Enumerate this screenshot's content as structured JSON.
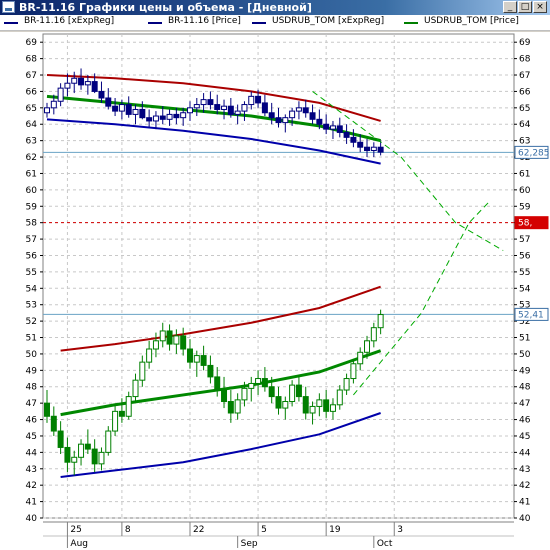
{
  "window": {
    "title": "BR-11.16 Графики цены и объема - [Дневной]",
    "buttons": [
      "_",
      "□",
      "×"
    ]
  },
  "legend": [
    {
      "label": "BR-11.16 [xExpReg]",
      "color": "#00007f"
    },
    {
      "label": "BR-11.16 [Price]",
      "color": "#00007f"
    },
    {
      "label": "USDRUB_TOM [xExpReg]",
      "color": "#00007f"
    },
    {
      "label": "USDRUB_TOM [Price]",
      "color": "#007f00"
    }
  ],
  "chart_data": {
    "type": "line",
    "ylim": [
      40,
      69.5
    ],
    "yticks": [
      40,
      41,
      42,
      43,
      44,
      45,
      46,
      47,
      48,
      49,
      50,
      51,
      52,
      53,
      54,
      55,
      56,
      57,
      58,
      59,
      60,
      61,
      62,
      63,
      64,
      65,
      66,
      67,
      68,
      69
    ],
    "xlim": [
      0,
      68
    ],
    "xticks": [
      {
        "x": 3,
        "label": "25"
      },
      {
        "x": 11,
        "label": "8"
      },
      {
        "x": 21,
        "label": "22"
      },
      {
        "x": 31,
        "label": "5"
      },
      {
        "x": 41,
        "label": "19"
      },
      {
        "x": 51,
        "label": "3"
      }
    ],
    "months": [
      {
        "x": 3,
        "label": "Aug"
      },
      {
        "x": 28,
        "label": "Sep"
      },
      {
        "x": 48,
        "label": "Oct"
      }
    ],
    "price_tags": [
      {
        "value": 62.285,
        "label": "62,285",
        "color": "#3a6ea5",
        "bg": "#ffffff",
        "line": "#6aa2c4",
        "dash": false
      },
      {
        "value": 58.0,
        "label": "58,",
        "color": "#ffffff",
        "bg": "#d40000",
        "line": "#d40000",
        "dash": true
      },
      {
        "value": 52.41,
        "label": "52,41",
        "color": "#3a6ea5",
        "bg": "#ffffff",
        "line": "#6aa2c4",
        "dash": false
      }
    ],
    "series": [
      {
        "name": "BR-11.16 [Price]",
        "kind": "candle",
        "color": "#00007f",
        "fill": "#ffffff",
        "values": [
          [
            0,
            64.7,
            65.3,
            64.4,
            65.0
          ],
          [
            1,
            65.0,
            65.8,
            64.6,
            65.4
          ],
          [
            2,
            65.4,
            66.5,
            65.1,
            66.2
          ],
          [
            3,
            66.2,
            67.1,
            65.7,
            66.5
          ],
          [
            4,
            66.5,
            67.2,
            65.9,
            66.8
          ],
          [
            5,
            66.8,
            67.4,
            66.1,
            66.4
          ],
          [
            6,
            66.4,
            67.0,
            65.8,
            66.6
          ],
          [
            7,
            66.6,
            67.1,
            65.9,
            66.0
          ],
          [
            8,
            66.0,
            66.6,
            65.3,
            65.6
          ],
          [
            9,
            65.6,
            66.2,
            64.9,
            65.1
          ],
          [
            10,
            65.1,
            65.6,
            64.5,
            64.8
          ],
          [
            11,
            64.8,
            65.5,
            64.3,
            65.2
          ],
          [
            12,
            65.2,
            65.7,
            64.4,
            64.6
          ],
          [
            13,
            64.6,
            65.2,
            64.0,
            64.9
          ],
          [
            14,
            64.9,
            65.4,
            64.3,
            64.4
          ],
          [
            15,
            64.4,
            64.9,
            63.8,
            64.2
          ],
          [
            16,
            64.2,
            64.8,
            63.7,
            64.5
          ],
          [
            17,
            64.5,
            65.1,
            64.0,
            64.3
          ],
          [
            18,
            64.3,
            64.9,
            63.9,
            64.6
          ],
          [
            19,
            64.6,
            65.0,
            64.0,
            64.4
          ],
          [
            20,
            64.4,
            65.0,
            63.9,
            64.7
          ],
          [
            21,
            64.7,
            65.4,
            64.2,
            65.0
          ],
          [
            22,
            65.0,
            65.6,
            64.5,
            65.2
          ],
          [
            23,
            65.2,
            65.9,
            64.7,
            65.5
          ],
          [
            24,
            65.5,
            66.0,
            64.9,
            65.2
          ],
          [
            25,
            65.2,
            65.8,
            64.6,
            64.9
          ],
          [
            26,
            64.9,
            65.5,
            64.3,
            65.1
          ],
          [
            27,
            65.1,
            65.6,
            64.4,
            64.6
          ],
          [
            28,
            64.6,
            65.2,
            64.0,
            64.8
          ],
          [
            29,
            64.8,
            65.4,
            64.2,
            65.2
          ],
          [
            30,
            65.2,
            66.0,
            64.9,
            65.7
          ],
          [
            31,
            65.7,
            66.1,
            65.0,
            65.3
          ],
          [
            32,
            65.3,
            65.8,
            64.5,
            64.7
          ],
          [
            33,
            64.7,
            65.3,
            64.0,
            64.4
          ],
          [
            34,
            64.4,
            65.0,
            63.8,
            64.1
          ],
          [
            35,
            64.1,
            64.6,
            63.5,
            64.4
          ],
          [
            36,
            64.4,
            65.0,
            63.9,
            64.8
          ],
          [
            37,
            64.8,
            65.4,
            64.3,
            65.0
          ],
          [
            38,
            65.0,
            65.5,
            64.4,
            64.7
          ],
          [
            39,
            64.7,
            65.2,
            64.0,
            64.3
          ],
          [
            40,
            64.3,
            64.9,
            63.7,
            64.0
          ],
          [
            41,
            64.0,
            64.6,
            63.4,
            63.7
          ],
          [
            42,
            63.7,
            64.2,
            63.1,
            63.9
          ],
          [
            43,
            63.9,
            64.4,
            63.2,
            63.5
          ],
          [
            44,
            63.5,
            64.0,
            62.8,
            63.2
          ],
          [
            45,
            63.2,
            63.7,
            62.6,
            62.9
          ],
          [
            46,
            62.9,
            63.4,
            62.3,
            62.6
          ],
          [
            47,
            62.6,
            63.1,
            62.0,
            62.4
          ],
          [
            48,
            62.4,
            62.9,
            62.0,
            62.6
          ],
          [
            49,
            62.6,
            63.0,
            62.1,
            62.3
          ]
        ]
      },
      {
        "name": "USDRUB_TOM [Price]",
        "kind": "candle",
        "color": "#007f00",
        "fill": "#ffffff",
        "values": [
          [
            0,
            47.0,
            47.8,
            45.8,
            46.2
          ],
          [
            1,
            46.2,
            46.8,
            45.0,
            45.3
          ],
          [
            2,
            45.3,
            45.9,
            43.9,
            44.3
          ],
          [
            3,
            44.3,
            44.9,
            42.8,
            43.4
          ],
          [
            4,
            43.4,
            44.1,
            42.6,
            43.7
          ],
          [
            5,
            43.7,
            44.8,
            43.2,
            44.5
          ],
          [
            6,
            44.5,
            45.4,
            43.9,
            44.2
          ],
          [
            7,
            44.2,
            44.8,
            42.8,
            43.3
          ],
          [
            8,
            43.3,
            44.3,
            42.9,
            44.0
          ],
          [
            9,
            44.0,
            45.6,
            43.8,
            45.3
          ],
          [
            10,
            45.3,
            46.9,
            45.0,
            46.5
          ],
          [
            11,
            46.5,
            47.3,
            45.8,
            46.2
          ],
          [
            12,
            46.2,
            47.7,
            46.0,
            47.4
          ],
          [
            13,
            47.4,
            48.8,
            47.1,
            48.4
          ],
          [
            14,
            48.4,
            49.9,
            48.0,
            49.5
          ],
          [
            15,
            49.5,
            50.8,
            49.1,
            50.3
          ],
          [
            16,
            50.3,
            51.3,
            49.8,
            50.8
          ],
          [
            17,
            50.8,
            51.9,
            50.4,
            51.4
          ],
          [
            18,
            51.4,
            51.8,
            50.2,
            50.6
          ],
          [
            19,
            50.6,
            51.5,
            50.0,
            51.1
          ],
          [
            20,
            51.1,
            51.6,
            49.9,
            50.3
          ],
          [
            21,
            50.3,
            50.9,
            49.1,
            49.5
          ],
          [
            22,
            49.5,
            50.2,
            48.6,
            49.9
          ],
          [
            23,
            49.9,
            50.5,
            49.0,
            49.3
          ],
          [
            24,
            49.3,
            49.9,
            48.2,
            48.6
          ],
          [
            25,
            48.6,
            49.2,
            47.4,
            47.8
          ],
          [
            26,
            47.8,
            48.6,
            46.7,
            47.1
          ],
          [
            27,
            47.1,
            47.8,
            45.8,
            46.4
          ],
          [
            28,
            46.4,
            47.6,
            46.0,
            47.2
          ],
          [
            29,
            47.2,
            48.3,
            46.8,
            47.9
          ],
          [
            30,
            47.9,
            48.6,
            47.1,
            48.2
          ],
          [
            31,
            48.2,
            49.0,
            47.5,
            48.5
          ],
          [
            32,
            48.5,
            49.2,
            47.7,
            48.0
          ],
          [
            33,
            48.0,
            48.6,
            47.0,
            47.4
          ],
          [
            34,
            47.4,
            48.0,
            46.3,
            46.7
          ],
          [
            35,
            46.7,
            47.4,
            46.0,
            47.1
          ],
          [
            36,
            47.1,
            48.4,
            46.8,
            48.1
          ],
          [
            37,
            48.1,
            48.7,
            47.1,
            47.4
          ],
          [
            38,
            47.4,
            48.0,
            46.0,
            46.4
          ],
          [
            39,
            46.4,
            47.1,
            45.7,
            46.8
          ],
          [
            40,
            46.8,
            47.6,
            46.2,
            47.2
          ],
          [
            41,
            47.2,
            47.8,
            46.1,
            46.5
          ],
          [
            42,
            46.5,
            47.3,
            46.0,
            46.9
          ],
          [
            43,
            46.9,
            48.1,
            46.6,
            47.8
          ],
          [
            44,
            47.8,
            48.8,
            47.5,
            48.5
          ],
          [
            45,
            48.5,
            49.7,
            48.2,
            49.4
          ],
          [
            46,
            49.4,
            50.4,
            49.0,
            50.1
          ],
          [
            47,
            50.1,
            51.1,
            49.7,
            50.8
          ],
          [
            48,
            50.8,
            51.9,
            50.4,
            51.6
          ],
          [
            49,
            51.6,
            52.7,
            51.2,
            52.4
          ]
        ]
      },
      {
        "name": "BR-11.16 [xExpReg]",
        "kind": "band",
        "upper": "#aa0000",
        "middle": "#008800",
        "lower": "#0000aa",
        "x": [
          0,
          10,
          20,
          30,
          40,
          49
        ],
        "upper_values": [
          67.0,
          66.8,
          66.5,
          66.0,
          65.3,
          64.2
        ],
        "middle_values": [
          65.7,
          65.3,
          64.9,
          64.5,
          63.9,
          63.0
        ],
        "lower_values": [
          64.3,
          64.0,
          63.6,
          63.1,
          62.4,
          61.6
        ]
      },
      {
        "name": "USDRUB_TOM [xExpReg]",
        "kind": "band",
        "upper": "#aa0000",
        "middle": "#008800",
        "lower": "#0000aa",
        "x": [
          2,
          10,
          20,
          30,
          40,
          49
        ],
        "upper_values": [
          50.2,
          50.6,
          51.2,
          51.9,
          52.8,
          54.1
        ],
        "middle_values": [
          46.3,
          46.9,
          47.5,
          48.1,
          48.9,
          50.2
        ],
        "lower_values": [
          42.5,
          42.9,
          43.4,
          44.2,
          45.1,
          46.4
        ]
      }
    ],
    "projections": [
      {
        "x": [
          39,
          52,
          60,
          67
        ],
        "values": [
          66.0,
          62.0,
          58.0,
          56.3
        ],
        "color": "#00aa00"
      },
      {
        "x": [
          45,
          55,
          62,
          65
        ],
        "values": [
          47.5,
          52.5,
          58.0,
          59.3
        ],
        "color": "#00aa00"
      }
    ]
  }
}
